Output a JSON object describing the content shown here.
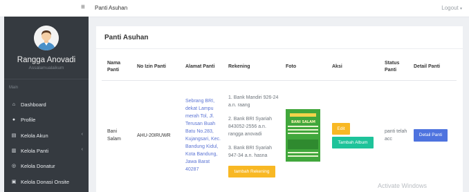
{
  "topbar": {
    "page_title": "Panti Asuhan",
    "logout_label": "Logout"
  },
  "sidebar": {
    "user_name": "Rangga Anovadi",
    "user_subtitle": "Assalamualaikum",
    "section_label": "Main",
    "items": [
      {
        "label": "Dashboard",
        "icon": "home-icon",
        "has_chevron": false
      },
      {
        "label": "Profile",
        "icon": "user-icon",
        "has_chevron": false
      },
      {
        "label": "Kelola Akun",
        "icon": "id-card-icon",
        "has_chevron": true
      },
      {
        "label": "Kelola Panti",
        "icon": "building-icon",
        "has_chevron": true
      },
      {
        "label": "Kelola Donatur",
        "icon": "handshake-icon",
        "has_chevron": false
      },
      {
        "label": "Kelola Donasi Onsite",
        "icon": "donation-icon",
        "has_chevron": false
      }
    ]
  },
  "card": {
    "title": "Panti Asuhan",
    "columns": [
      "Nama Panti",
      "No Izin Panti",
      "Alamat Panti",
      "Rekening",
      "Foto",
      "Aksi",
      "Status Panti",
      "Detail Panti"
    ],
    "rows": [
      {
        "nama": "Bani Salam",
        "no_izin": "AHU-20IRUWR",
        "alamat": "Sebrang BRI, dekat Lampu merah Tol, Jl. Terusan Buah Batu No.283, Kujangsari, Kec. Bandung Kidul, Kota Bandung, Jawa Barat 40287",
        "rekening": [
          "1. Bank Mandiri 926-24 a.n. raang",
          "2. Bank BRI Syariah 843052-2556 a.n. rangga anovadi",
          "3. Bank BRI Syariah 947-34 a.n. hasna"
        ],
        "tambah_rekening_label": "tambah Rekening",
        "foto_caption": "BANI SALAM",
        "edit_label": "Edit",
        "tambah_album_label": "Tambah Album",
        "status": "panti telah acc",
        "detail_label": "Detail Panti"
      }
    ]
  },
  "watermark": "Activate Windows",
  "colors": {
    "sidebar_bg": "#353a40",
    "primary": "#4e73df",
    "warning": "#f8b824",
    "success": "#1ec39a",
    "link": "#5b74d4"
  }
}
